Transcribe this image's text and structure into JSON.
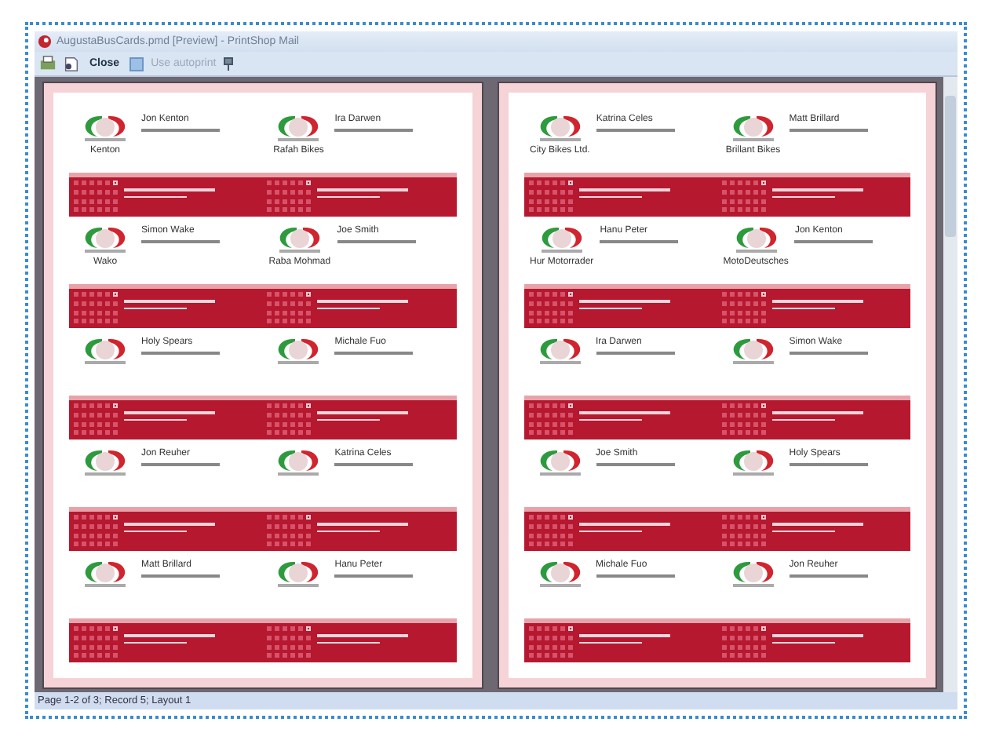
{
  "window": {
    "title": "AugustaBusCards.pmd [Preview] - PrintShop Mail"
  },
  "toolbar": {
    "close_label": "Close",
    "autoprint": {
      "label": "Use autoprint",
      "disabled": true
    }
  },
  "pages": [
    {
      "cards": [
        {
          "name": "Jon Kenton",
          "company": "Kenton"
        },
        {
          "name": "Ira Darwen",
          "company": "Rafah Bikes"
        },
        {
          "name": "Simon Wake",
          "company": "Wako"
        },
        {
          "name": "Joe Smith",
          "company": "Raba Mohmad"
        },
        {
          "name": "Holy Spears"
        },
        {
          "name": "Michale Fuo"
        },
        {
          "name": "Jon Reuher"
        },
        {
          "name": "Katrina Celes"
        },
        {
          "name": "Matt Brillard"
        },
        {
          "name": "Hanu Peter"
        }
      ]
    },
    {
      "cards": [
        {
          "name": "Katrina Celes",
          "company": "City Bikes Ltd."
        },
        {
          "name": "Matt Brillard",
          "company": "Brillant Bikes"
        },
        {
          "name": "Hanu Peter",
          "company": "Hur Motorrader"
        },
        {
          "name": "Jon Kenton",
          "company": "MotoDeutsches"
        },
        {
          "name": "Ira Darwen"
        },
        {
          "name": "Simon Wake"
        },
        {
          "name": "Joe Smith"
        },
        {
          "name": "Holy Spears"
        },
        {
          "name": "Michale Fuo"
        },
        {
          "name": "Jon Reuher"
        }
      ]
    }
  ],
  "status_bar": "Page 1-2 of 3; Record 5; Layout 1"
}
